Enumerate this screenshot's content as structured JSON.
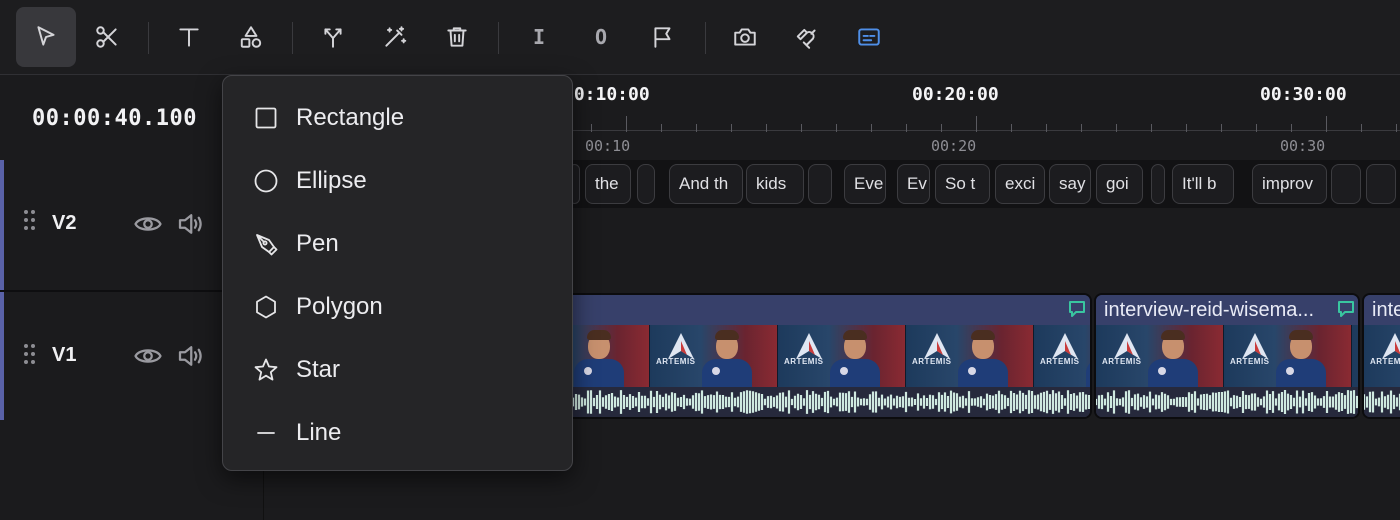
{
  "toolbar": {
    "tools": [
      {
        "name": "select-tool",
        "icon": "cursor-arrow-icon",
        "active": true
      },
      {
        "name": "cut-tool",
        "icon": "scissors-icon"
      },
      {
        "name": "text-tool",
        "icon": "text-t-icon"
      },
      {
        "name": "shapes-tool",
        "icon": "shapes-icon"
      },
      {
        "name": "split-tool",
        "icon": "fork-arrows-icon"
      },
      {
        "name": "magic-tool",
        "icon": "magic-wand-icon"
      },
      {
        "name": "delete-tool",
        "icon": "trash-icon"
      },
      {
        "name": "mark-in-tool",
        "icon": "mark-in-icon",
        "glyph": "I"
      },
      {
        "name": "mark-out-tool",
        "icon": "mark-out-icon",
        "glyph": "O"
      },
      {
        "name": "marker-tool",
        "icon": "flag-icon"
      },
      {
        "name": "snapshot-tool",
        "icon": "camera-icon"
      },
      {
        "name": "snapping-tool",
        "icon": "magnet-icon"
      },
      {
        "name": "captions-tool",
        "icon": "subtitles-icon",
        "color": "#4f8fe8"
      }
    ]
  },
  "playhead": {
    "timecode": "00:00:40.100"
  },
  "tracks": [
    {
      "name": "V2"
    },
    {
      "name": "V1"
    }
  ],
  "ruler": {
    "major": [
      "00:10:00",
      "00:20:00",
      "00:30:00"
    ],
    "minor": [
      "00:10",
      "00:20",
      "00:30"
    ]
  },
  "captions": [
    "",
    "the",
    "",
    "And th",
    "kids",
    "",
    "Eve",
    "Ev",
    "So t",
    "exci",
    "say",
    "goi",
    "",
    "It'll b",
    "improv",
    "",
    ""
  ],
  "clips": [
    {
      "title": "",
      "has_comment": true
    },
    {
      "title": "interview-reid-wisema...",
      "has_comment": true
    },
    {
      "title": "inte",
      "has_comment": false
    }
  ],
  "frame_logo_text": "ARTEMIS",
  "shape_menu": {
    "items": [
      {
        "label": "Rectangle",
        "icon": "square-icon"
      },
      {
        "label": "Ellipse",
        "icon": "circle-icon"
      },
      {
        "label": "Pen",
        "icon": "pen-nib-icon"
      },
      {
        "label": "Polygon",
        "icon": "hexagon-icon"
      },
      {
        "label": "Star",
        "icon": "star-icon"
      },
      {
        "label": "Line",
        "icon": "line-icon"
      }
    ]
  },
  "colors": {
    "accent": "#4f8fe8",
    "track_marker": "#5a62a8",
    "comment": "#39c6a0",
    "clip_header": "#37406a"
  }
}
